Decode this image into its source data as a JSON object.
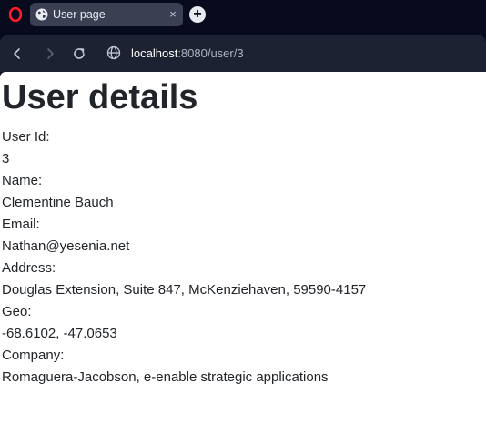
{
  "browser": {
    "tab": {
      "title": "User page",
      "close": "×"
    },
    "new_tab": "+",
    "address": {
      "host": "localhost",
      "path": ":8080/user/3"
    },
    "icons": {
      "logo": "opera-logo",
      "tab_favicon": "globe-icon",
      "back": "arrow-left-icon",
      "forward": "arrow-right-icon",
      "reload": "reload-icon",
      "site_info": "globe-icon"
    }
  },
  "page": {
    "heading": "User details",
    "fields": [
      {
        "label": "User Id:",
        "value": "3"
      },
      {
        "label": "Name:",
        "value": "Clementine Bauch"
      },
      {
        "label": "Email:",
        "value": "Nathan@yesenia.net"
      },
      {
        "label": "Address:",
        "value": "Douglas Extension, Suite 847, McKenziehaven, 59590-4157"
      },
      {
        "label": "Geo:",
        "value": "-68.6102, -47.0653"
      },
      {
        "label": "Company:",
        "value": "Romaguera-Jacobson, e-enable strategic applications"
      }
    ]
  },
  "colors": {
    "chrome_background": "#070b1d",
    "toolbar_background": "#1d2233",
    "tab_active": "#3a3f52",
    "opera_red": "#ff1b2d",
    "page_background": "#ffffff",
    "text": "#212529"
  }
}
